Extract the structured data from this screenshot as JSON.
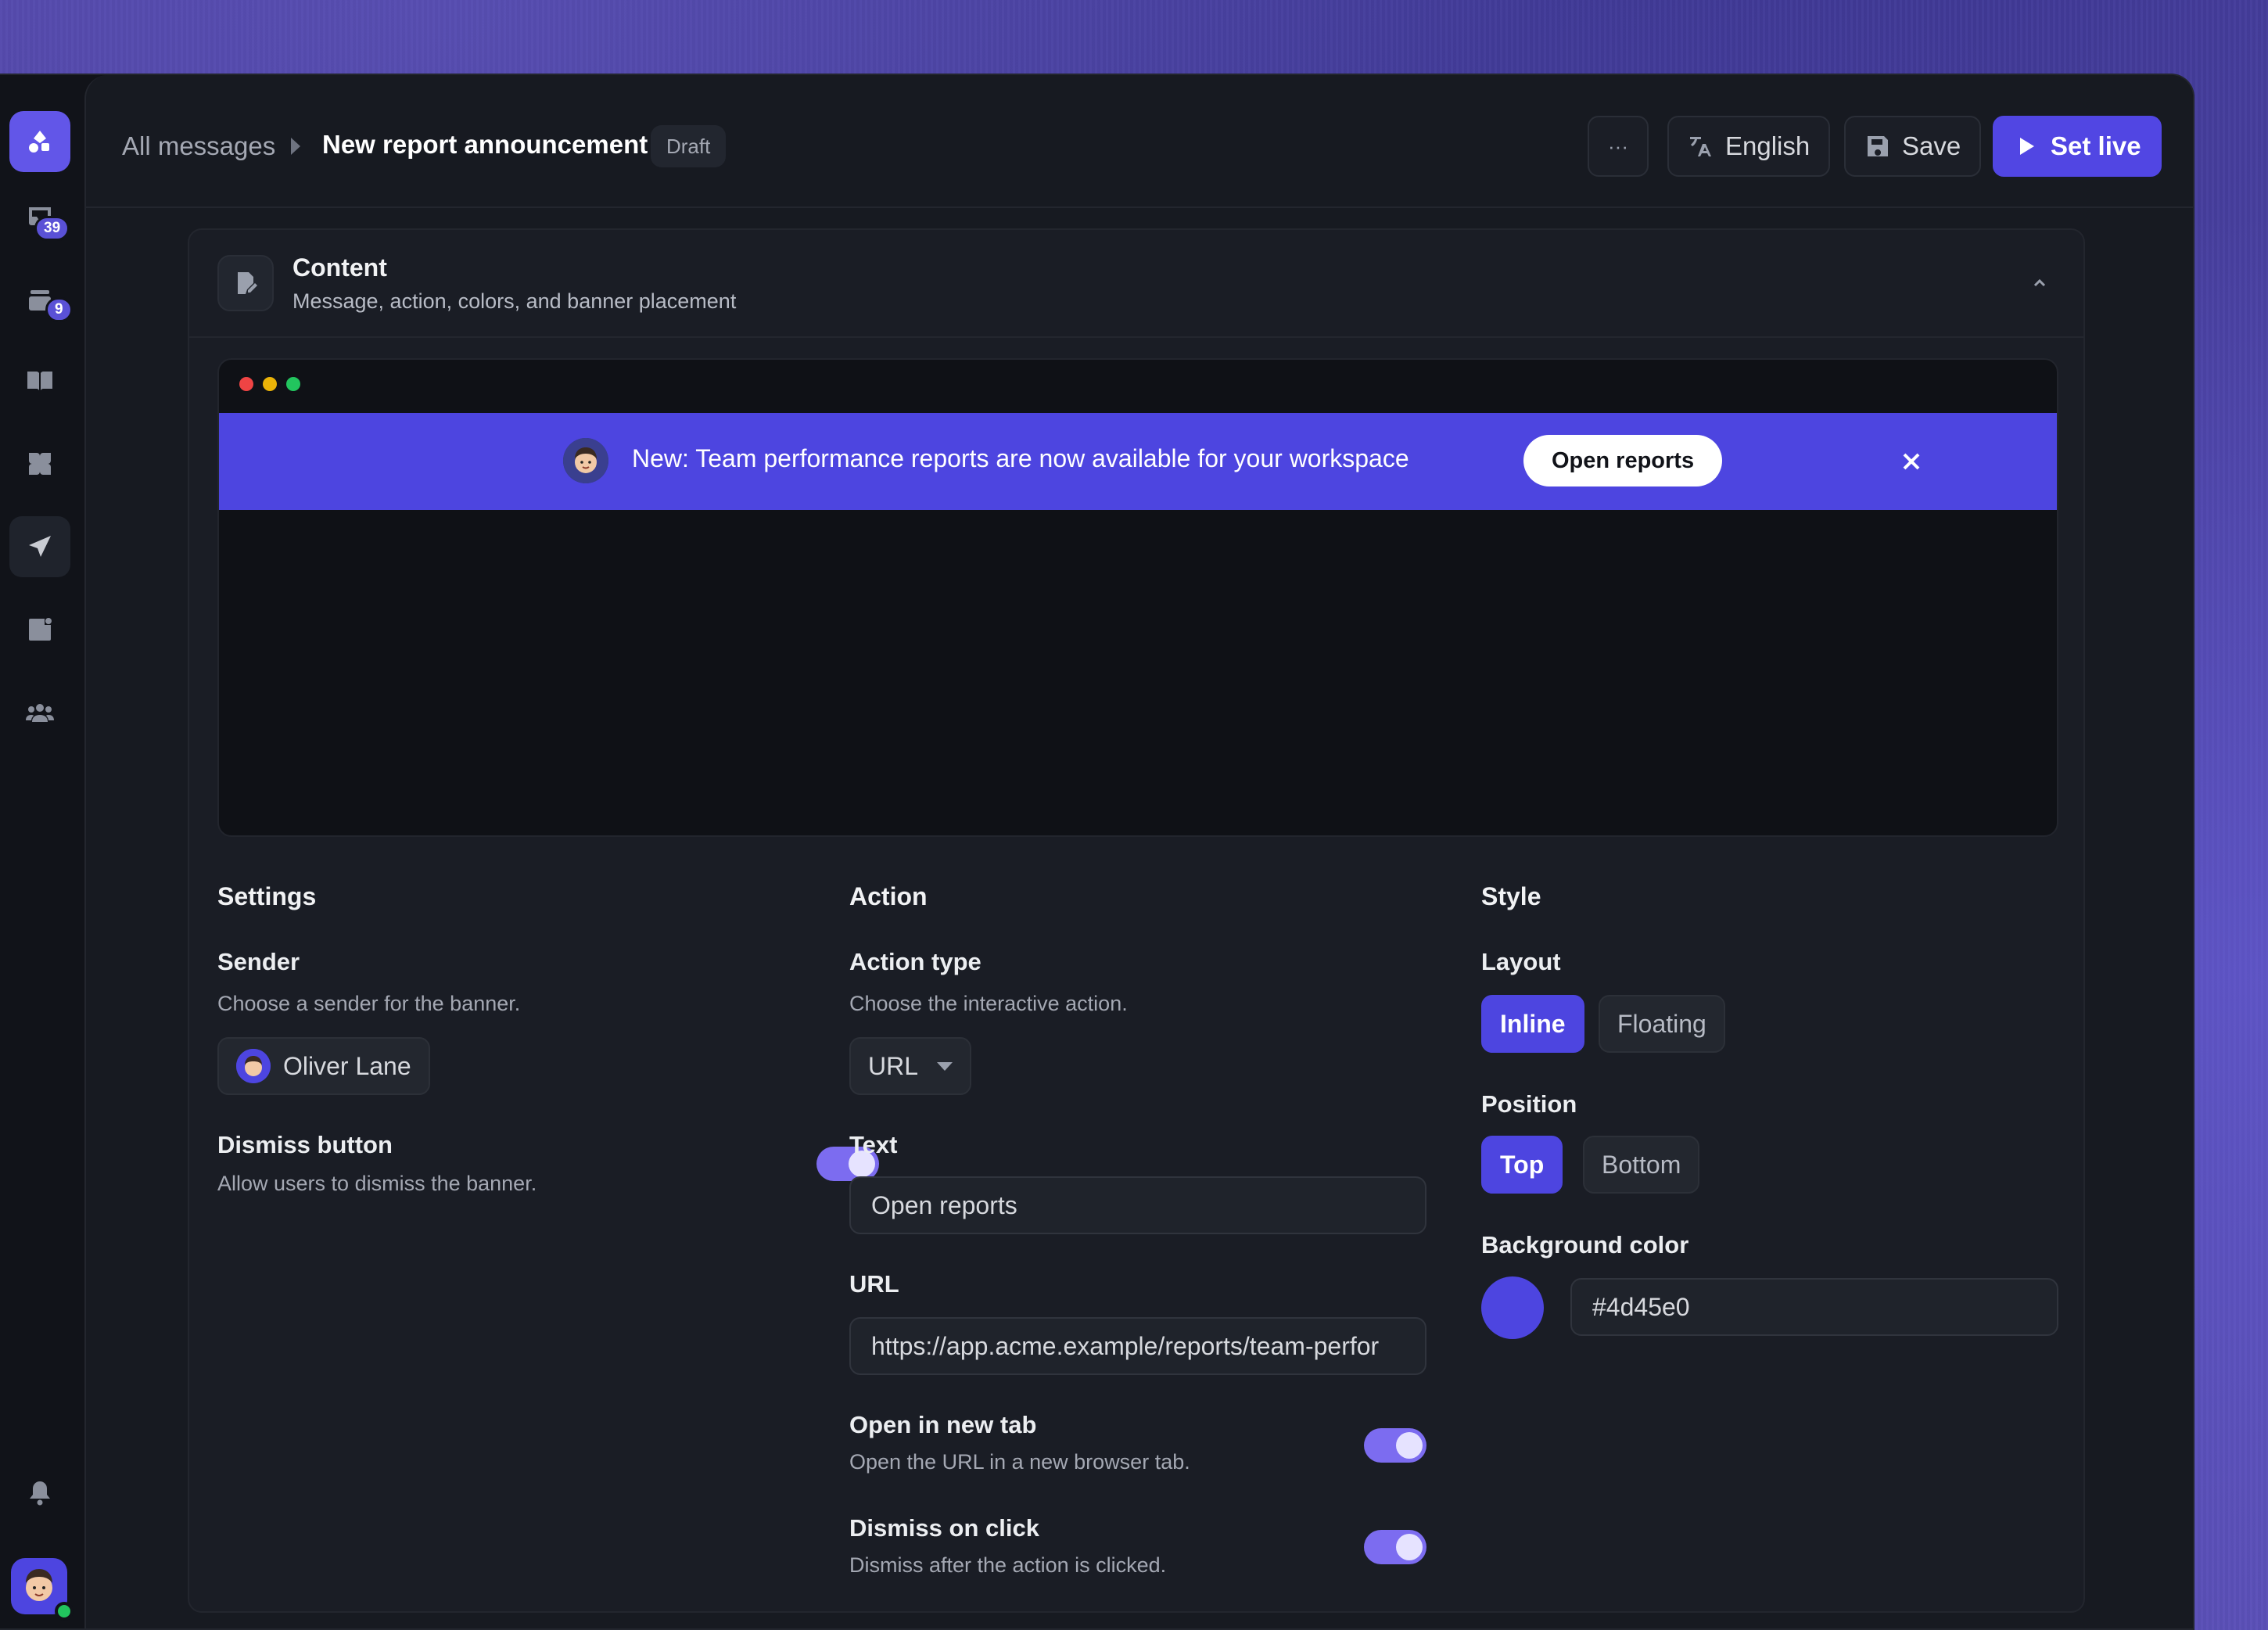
{
  "header": {
    "breadcrumb_root": "All messages",
    "title": "New report announcement",
    "status": "Draft",
    "more_label": "···",
    "language_label": "English",
    "save_label": "Save",
    "set_live_label": "Set live"
  },
  "rail": {
    "badges": {
      "inbox": "39",
      "tickets": "9"
    }
  },
  "content_card": {
    "title": "Content",
    "subtitle": "Message, action, colors, and banner placement"
  },
  "preview": {
    "banner_text": "New: Team performance reports are now available for your workspace",
    "banner_button": "Open reports",
    "banner_color": "#4d45e0"
  },
  "settings": {
    "heading": "Settings",
    "sender_label": "Sender",
    "sender_help": "Choose a sender for the banner.",
    "sender_value": "Oliver Lane",
    "dismiss_label": "Dismiss button",
    "dismiss_help": "Allow users to dismiss the banner.",
    "dismiss_on": true
  },
  "action": {
    "heading": "Action",
    "type_label": "Action type",
    "type_help": "Choose the interactive action.",
    "type_value": "URL",
    "text_label": "Text",
    "text_value": "Open reports",
    "url_label": "URL",
    "url_value": "https://app.acme.example/reports/team-perfor",
    "new_tab_label": "Open in new tab",
    "new_tab_help": "Open the URL in a new browser tab.",
    "new_tab_on": true,
    "dismiss_click_label": "Dismiss on click",
    "dismiss_click_help": "Dismiss after the action is clicked.",
    "dismiss_click_on": true
  },
  "style": {
    "heading": "Style",
    "layout_label": "Layout",
    "layout_options": [
      "Inline",
      "Floating"
    ],
    "layout_selected": "Inline",
    "position_label": "Position",
    "position_options": [
      "Top",
      "Bottom"
    ],
    "position_selected": "Top",
    "bg_label": "Background color",
    "bg_value": "#4d45e0"
  },
  "colors": {
    "accent": "#4d45e0",
    "toggle": "#7c6cf0",
    "dot_red": "#ef4444",
    "dot_yellow": "#eab308",
    "dot_green": "#22c55e"
  }
}
